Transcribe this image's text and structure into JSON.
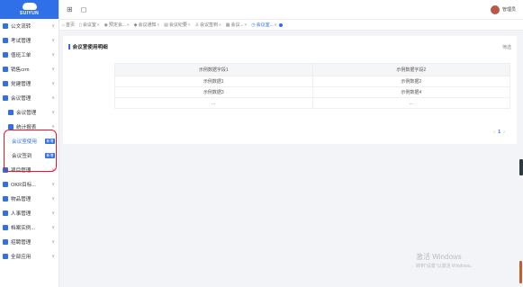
{
  "brand": {
    "logo_text": "SUIYUN"
  },
  "header": {
    "user_name": "管理员"
  },
  "sidebar": {
    "items": [
      {
        "label": "公文流转"
      },
      {
        "label": "考试管理"
      },
      {
        "label": "值班工单"
      },
      {
        "label": "销售crm"
      },
      {
        "label": "党建管理"
      },
      {
        "label": "会议管理"
      },
      {
        "label": "会议管理"
      },
      {
        "label": "统计报表"
      },
      {
        "label": "会议室使用",
        "tag": "新增"
      },
      {
        "label": "会议签到",
        "tag": "新增"
      },
      {
        "label": "项目管理"
      },
      {
        "label": "OKR目标..."
      },
      {
        "label": "物品管理"
      },
      {
        "label": "人事管理"
      },
      {
        "label": "档案实例..."
      },
      {
        "label": "招聘管理"
      },
      {
        "label": "全部应用"
      }
    ]
  },
  "tabs": [
    {
      "label": "首页",
      "icon": "home-icon"
    },
    {
      "label": "会议室",
      "icon": "door-icon"
    },
    {
      "label": "预定会...",
      "icon": "calendar-icon"
    },
    {
      "label": "会议通知",
      "icon": "bell-icon"
    },
    {
      "label": "会议纪要",
      "icon": "doc-icon"
    },
    {
      "label": "会议签到",
      "icon": "user-icon"
    },
    {
      "label": "会议...",
      "icon": "list-icon"
    },
    {
      "label": "会议室...",
      "icon": "clock-icon",
      "active": true
    }
  ],
  "panel": {
    "title": "会议室使用明细",
    "filter_label": "筛选",
    "columns": [
      "示例数据字段1",
      "示例数据字段2"
    ],
    "rows": [
      [
        "示例数据1",
        "示例数据2"
      ],
      [
        "示例数据3",
        "示例数据4"
      ],
      [
        "...",
        "..."
      ]
    ],
    "pager": {
      "prev": "‹",
      "current": "1",
      "next": "›"
    }
  },
  "watermark": {
    "line1": "激活 Windows",
    "line2": "转到\"设置\"以激活 Windows。"
  }
}
